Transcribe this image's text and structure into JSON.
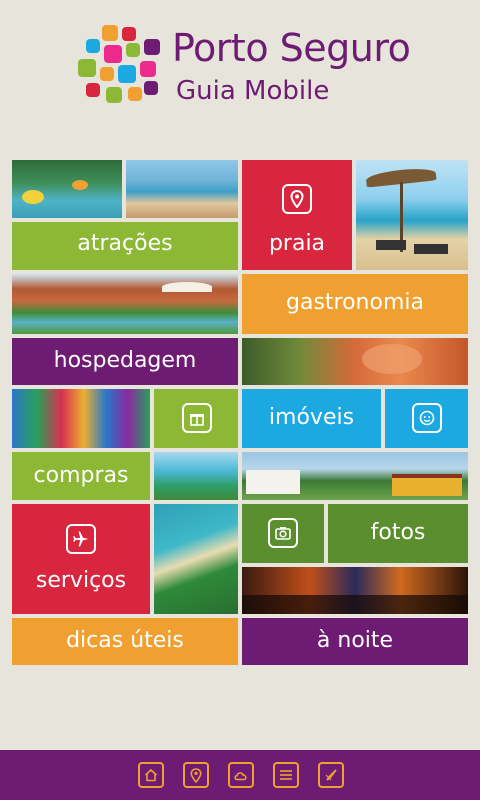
{
  "header": {
    "title_line1": "Porto Seguro",
    "title_line2": "Guia Mobile"
  },
  "tiles": {
    "atracoes": "atrações",
    "praia": "praia",
    "gastronomia": "gastronomia",
    "hospedagem": "hospedagem",
    "imoveis": "imóveis",
    "compras": "compras",
    "fotos": "fotos",
    "servicos": "serviços",
    "dicas": "dicas úteis",
    "noite": "à noite"
  },
  "icons": {
    "praia": "map-pin-icon",
    "compras": "gift-icon",
    "imoveis": "face-icon",
    "servicos": "airplane-icon",
    "fotos": "camera-icon"
  },
  "bottom_nav": [
    "home-icon",
    "map-pin-icon",
    "weather-icon",
    "list-icon",
    "compass-icon"
  ],
  "colors": {
    "green": "#8cb836",
    "red": "#d8263f",
    "orange": "#f0a030",
    "purple": "#6d1b73",
    "blue": "#1ca8e0",
    "dark_green": "#5a8e2e"
  }
}
